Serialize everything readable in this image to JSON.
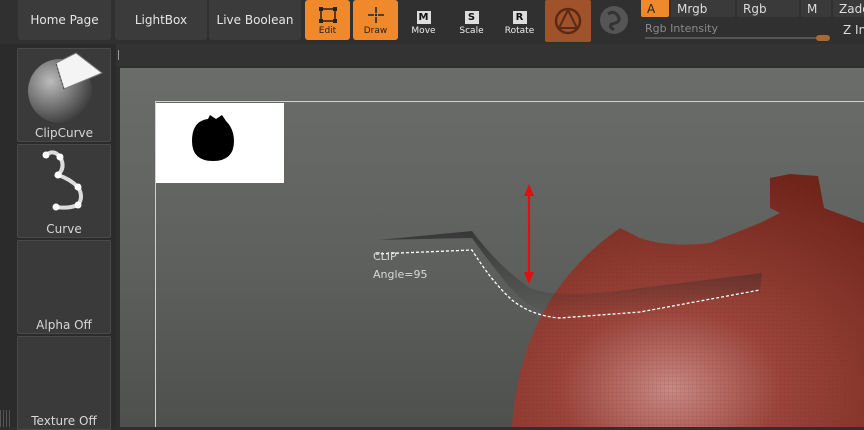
{
  "nav": {
    "home_page": "Home Page",
    "lightbox": "LightBox",
    "live_boolean": "Live Boolean"
  },
  "tools": {
    "edit": "Edit",
    "draw": "Draw",
    "move": "Move",
    "move_key": "M",
    "scale": "Scale",
    "scale_key": "S",
    "rotate": "Rotate",
    "rotate_key": "R"
  },
  "color_modes": {
    "a": "A",
    "mrgb": "Mrgb",
    "rgb": "Rgb",
    "m": "M",
    "zadd": "Zadd",
    "zint": "Z In"
  },
  "rgb_intensity": {
    "label": "Rgb Intensity",
    "value": 0.93
  },
  "left_panel": {
    "clipcurve": "ClipCurve",
    "curve": "Curve",
    "alpha_off": "Alpha Off",
    "texture_off": "Texture Off"
  },
  "viewport": {
    "clip_label": "CLIP",
    "angle_label": "Angle=95"
  },
  "colors": {
    "accent": "#f0892b",
    "model_red": "#8e3a30",
    "arrow_red": "#e01010"
  }
}
